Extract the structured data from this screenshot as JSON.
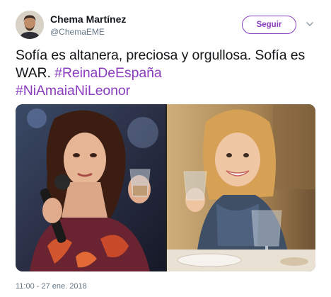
{
  "author": {
    "display_name": "Chema Martínez",
    "handle": "@ChemaEME"
  },
  "actions": {
    "follow_label": "Seguir"
  },
  "tweet": {
    "text_part1": "Sofía es altanera, preciosa y orgullosa. Sofía es WAR. ",
    "hashtag1": "#ReinaDeEspaña",
    "hashtag2": "#NiAmaiaNiLeonor"
  },
  "media": {
    "photo_count": 2
  },
  "meta": {
    "timestamp": "11:00 - 27 ene. 2018"
  },
  "colors": {
    "accent": "#8b3dbf",
    "text": "#14171a",
    "secondary": "#657786"
  },
  "icons": {
    "caret": "chevron-down-icon"
  }
}
